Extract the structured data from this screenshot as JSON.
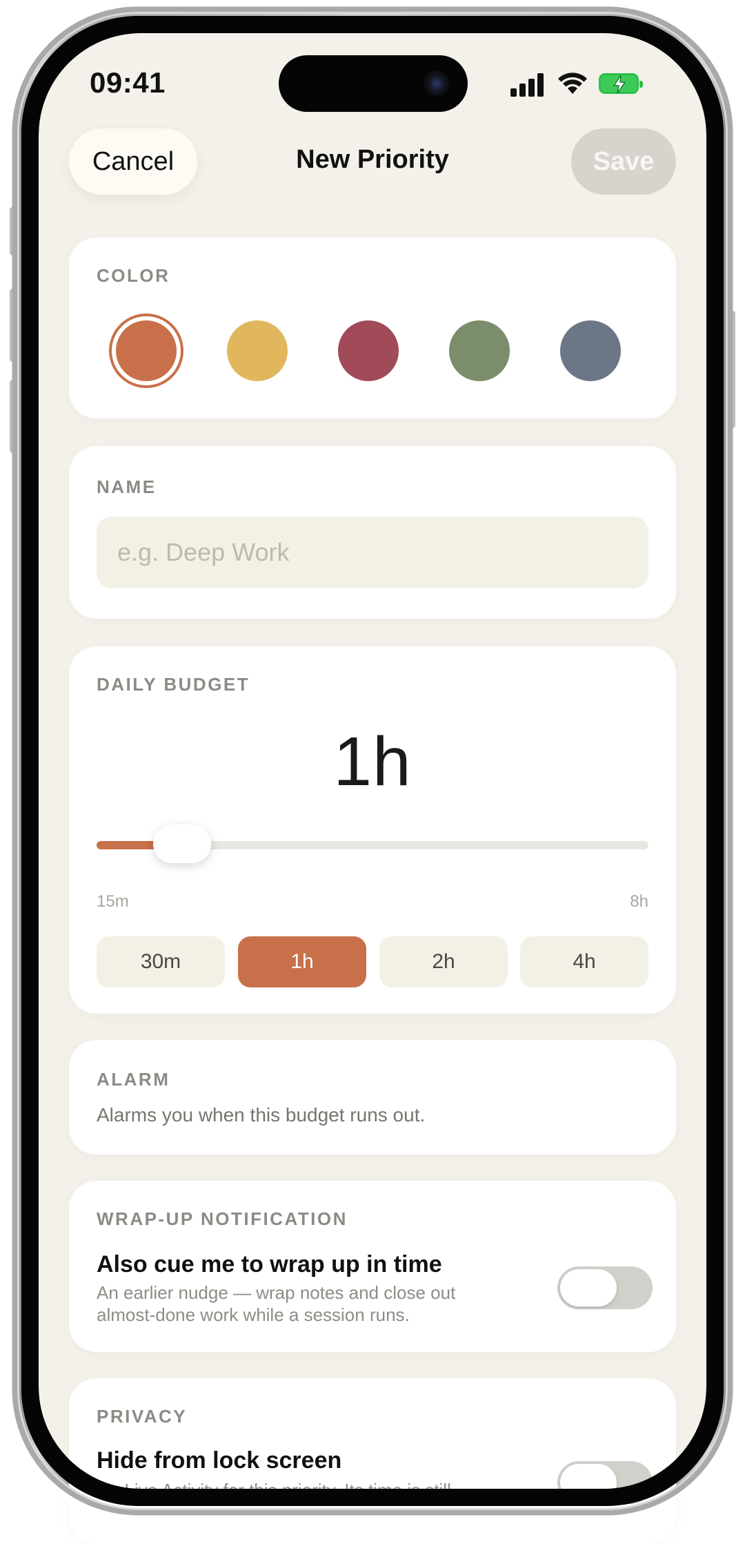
{
  "status_bar": {
    "time": "09:41",
    "icons": [
      "signal-icon",
      "wifi-icon",
      "battery-charging-icon"
    ]
  },
  "nav": {
    "cancel_label": "Cancel",
    "title": "New Priority",
    "save_label": "Save"
  },
  "color_section": {
    "label": "COLOR",
    "swatches": [
      {
        "name": "orange",
        "color": "#c8704a",
        "selected": true
      },
      {
        "name": "yellow",
        "color": "#e0b75d",
        "selected": false
      },
      {
        "name": "red",
        "color": "#a14a58",
        "selected": false
      },
      {
        "name": "green",
        "color": "#7b8d6b",
        "selected": false
      },
      {
        "name": "slate",
        "color": "#6b7686",
        "selected": false
      }
    ]
  },
  "name_section": {
    "label": "NAME",
    "value": "",
    "placeholder": "e.g. Deep Work"
  },
  "budget_section": {
    "label": "DAILY BUDGET",
    "value": "1h",
    "slider_fraction": 0.11,
    "min_label": "15m",
    "max_label": "8h",
    "presets": [
      {
        "label": "30m",
        "active": false
      },
      {
        "label": "1h",
        "active": true
      },
      {
        "label": "2h",
        "active": false
      },
      {
        "label": "4h",
        "active": false
      }
    ]
  },
  "alarm_section": {
    "label": "ALARM",
    "description": "Alarms you when this budget runs out."
  },
  "wrapup_section": {
    "label": "WRAP-UP NOTIFICATION",
    "title": "Also cue me to wrap up in time",
    "subtitle": "An earlier nudge — wrap notes and close out almost-done work while a session runs.",
    "enabled": false
  },
  "privacy_section": {
    "label": "PRIVACY",
    "title": "Hide from lock screen",
    "subtitle": "No Live Activity for this priority. Its time is still",
    "enabled": false
  },
  "colors": {
    "accent": "#c8704a",
    "background": "#f3f1ea",
    "card": "#ffffff"
  }
}
